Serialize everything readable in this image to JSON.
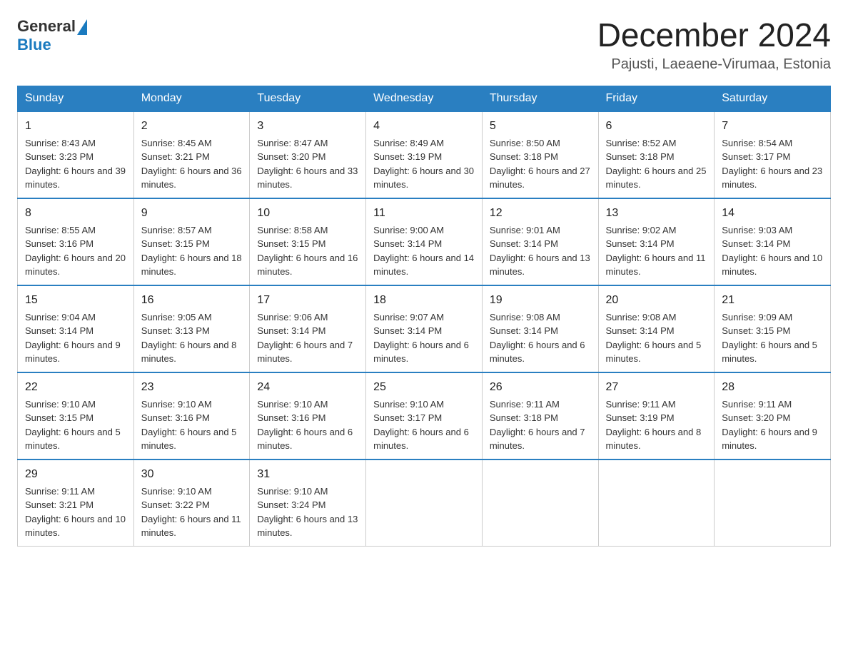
{
  "header": {
    "logo_general": "General",
    "logo_blue": "Blue",
    "month_title": "December 2024",
    "location": "Pajusti, Laeaene-Virumaa, Estonia"
  },
  "weekdays": [
    "Sunday",
    "Monday",
    "Tuesday",
    "Wednesday",
    "Thursday",
    "Friday",
    "Saturday"
  ],
  "weeks": [
    [
      {
        "day": "1",
        "sunrise": "Sunrise: 8:43 AM",
        "sunset": "Sunset: 3:23 PM",
        "daylight": "Daylight: 6 hours and 39 minutes."
      },
      {
        "day": "2",
        "sunrise": "Sunrise: 8:45 AM",
        "sunset": "Sunset: 3:21 PM",
        "daylight": "Daylight: 6 hours and 36 minutes."
      },
      {
        "day": "3",
        "sunrise": "Sunrise: 8:47 AM",
        "sunset": "Sunset: 3:20 PM",
        "daylight": "Daylight: 6 hours and 33 minutes."
      },
      {
        "day": "4",
        "sunrise": "Sunrise: 8:49 AM",
        "sunset": "Sunset: 3:19 PM",
        "daylight": "Daylight: 6 hours and 30 minutes."
      },
      {
        "day": "5",
        "sunrise": "Sunrise: 8:50 AM",
        "sunset": "Sunset: 3:18 PM",
        "daylight": "Daylight: 6 hours and 27 minutes."
      },
      {
        "day": "6",
        "sunrise": "Sunrise: 8:52 AM",
        "sunset": "Sunset: 3:18 PM",
        "daylight": "Daylight: 6 hours and 25 minutes."
      },
      {
        "day": "7",
        "sunrise": "Sunrise: 8:54 AM",
        "sunset": "Sunset: 3:17 PM",
        "daylight": "Daylight: 6 hours and 23 minutes."
      }
    ],
    [
      {
        "day": "8",
        "sunrise": "Sunrise: 8:55 AM",
        "sunset": "Sunset: 3:16 PM",
        "daylight": "Daylight: 6 hours and 20 minutes."
      },
      {
        "day": "9",
        "sunrise": "Sunrise: 8:57 AM",
        "sunset": "Sunset: 3:15 PM",
        "daylight": "Daylight: 6 hours and 18 minutes."
      },
      {
        "day": "10",
        "sunrise": "Sunrise: 8:58 AM",
        "sunset": "Sunset: 3:15 PM",
        "daylight": "Daylight: 6 hours and 16 minutes."
      },
      {
        "day": "11",
        "sunrise": "Sunrise: 9:00 AM",
        "sunset": "Sunset: 3:14 PM",
        "daylight": "Daylight: 6 hours and 14 minutes."
      },
      {
        "day": "12",
        "sunrise": "Sunrise: 9:01 AM",
        "sunset": "Sunset: 3:14 PM",
        "daylight": "Daylight: 6 hours and 13 minutes."
      },
      {
        "day": "13",
        "sunrise": "Sunrise: 9:02 AM",
        "sunset": "Sunset: 3:14 PM",
        "daylight": "Daylight: 6 hours and 11 minutes."
      },
      {
        "day": "14",
        "sunrise": "Sunrise: 9:03 AM",
        "sunset": "Sunset: 3:14 PM",
        "daylight": "Daylight: 6 hours and 10 minutes."
      }
    ],
    [
      {
        "day": "15",
        "sunrise": "Sunrise: 9:04 AM",
        "sunset": "Sunset: 3:14 PM",
        "daylight": "Daylight: 6 hours and 9 minutes."
      },
      {
        "day": "16",
        "sunrise": "Sunrise: 9:05 AM",
        "sunset": "Sunset: 3:13 PM",
        "daylight": "Daylight: 6 hours and 8 minutes."
      },
      {
        "day": "17",
        "sunrise": "Sunrise: 9:06 AM",
        "sunset": "Sunset: 3:14 PM",
        "daylight": "Daylight: 6 hours and 7 minutes."
      },
      {
        "day": "18",
        "sunrise": "Sunrise: 9:07 AM",
        "sunset": "Sunset: 3:14 PM",
        "daylight": "Daylight: 6 hours and 6 minutes."
      },
      {
        "day": "19",
        "sunrise": "Sunrise: 9:08 AM",
        "sunset": "Sunset: 3:14 PM",
        "daylight": "Daylight: 6 hours and 6 minutes."
      },
      {
        "day": "20",
        "sunrise": "Sunrise: 9:08 AM",
        "sunset": "Sunset: 3:14 PM",
        "daylight": "Daylight: 6 hours and 5 minutes."
      },
      {
        "day": "21",
        "sunrise": "Sunrise: 9:09 AM",
        "sunset": "Sunset: 3:15 PM",
        "daylight": "Daylight: 6 hours and 5 minutes."
      }
    ],
    [
      {
        "day": "22",
        "sunrise": "Sunrise: 9:10 AM",
        "sunset": "Sunset: 3:15 PM",
        "daylight": "Daylight: 6 hours and 5 minutes."
      },
      {
        "day": "23",
        "sunrise": "Sunrise: 9:10 AM",
        "sunset": "Sunset: 3:16 PM",
        "daylight": "Daylight: 6 hours and 5 minutes."
      },
      {
        "day": "24",
        "sunrise": "Sunrise: 9:10 AM",
        "sunset": "Sunset: 3:16 PM",
        "daylight": "Daylight: 6 hours and 6 minutes."
      },
      {
        "day": "25",
        "sunrise": "Sunrise: 9:10 AM",
        "sunset": "Sunset: 3:17 PM",
        "daylight": "Daylight: 6 hours and 6 minutes."
      },
      {
        "day": "26",
        "sunrise": "Sunrise: 9:11 AM",
        "sunset": "Sunset: 3:18 PM",
        "daylight": "Daylight: 6 hours and 7 minutes."
      },
      {
        "day": "27",
        "sunrise": "Sunrise: 9:11 AM",
        "sunset": "Sunset: 3:19 PM",
        "daylight": "Daylight: 6 hours and 8 minutes."
      },
      {
        "day": "28",
        "sunrise": "Sunrise: 9:11 AM",
        "sunset": "Sunset: 3:20 PM",
        "daylight": "Daylight: 6 hours and 9 minutes."
      }
    ],
    [
      {
        "day": "29",
        "sunrise": "Sunrise: 9:11 AM",
        "sunset": "Sunset: 3:21 PM",
        "daylight": "Daylight: 6 hours and 10 minutes."
      },
      {
        "day": "30",
        "sunrise": "Sunrise: 9:10 AM",
        "sunset": "Sunset: 3:22 PM",
        "daylight": "Daylight: 6 hours and 11 minutes."
      },
      {
        "day": "31",
        "sunrise": "Sunrise: 9:10 AM",
        "sunset": "Sunset: 3:24 PM",
        "daylight": "Daylight: 6 hours and 13 minutes."
      },
      null,
      null,
      null,
      null
    ]
  ]
}
